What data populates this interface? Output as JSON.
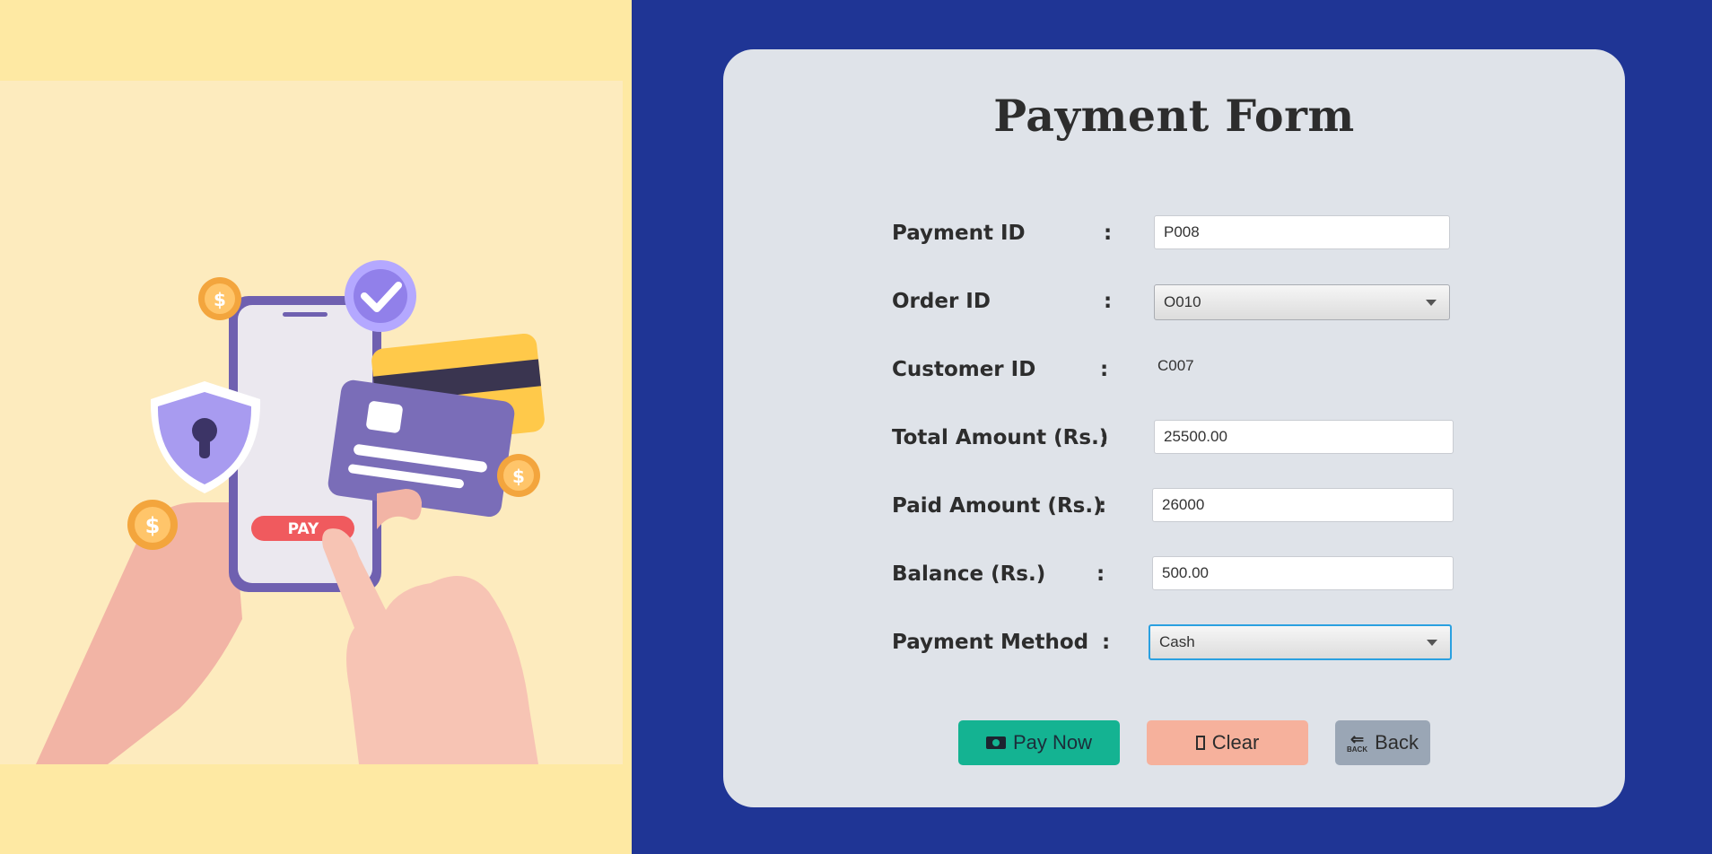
{
  "form": {
    "title": "Payment Form",
    "fields": {
      "payment_id": {
        "label": "Payment ID",
        "value": "P008"
      },
      "order_id": {
        "label": "Order ID",
        "value": "O010"
      },
      "customer_id": {
        "label": "Customer ID",
        "value": "C007"
      },
      "total_amount": {
        "label": "Total Amount (Rs.)",
        "value": "25500.00"
      },
      "paid_amount": {
        "label": "Paid Amount (Rs.)",
        "value": "26000"
      },
      "balance": {
        "label": "Balance (Rs.)",
        "value": "500.00"
      },
      "payment_method": {
        "label": "Payment Method",
        "value": "Cash"
      }
    },
    "colon": ":"
  },
  "buttons": {
    "pay_now": "Pay Now",
    "clear": "Clear",
    "back": "Back",
    "back_icon_text": "BACK"
  },
  "illustration": {
    "pay_button_text": "PAY",
    "coin_symbol": "$"
  },
  "colors": {
    "left_background": "#fee9a3",
    "right_background": "#1f3595",
    "card_background": "#dfe3e9",
    "pay_button": "#14b392",
    "clear_button": "#f6b19c",
    "back_button": "#9aa6b5",
    "focus_border": "#2aa0e0"
  },
  "icons": {
    "pay_now": "cash-icon",
    "clear": "clear-icon",
    "back": "back-arrow-icon",
    "dropdown": "chevron-down-icon"
  }
}
